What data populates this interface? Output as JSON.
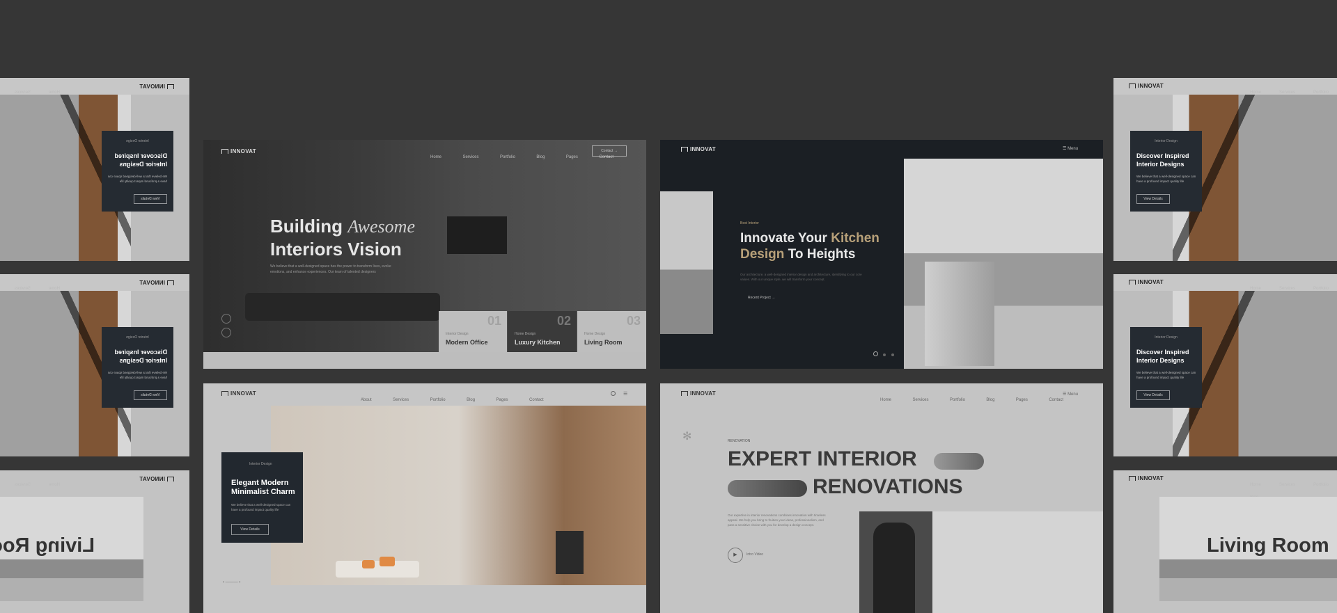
{
  "brand": "INNOVAT",
  "side_cards": {
    "menu": [
      "Home",
      "Services",
      "Portfolio",
      "Blog"
    ],
    "eyebrow": "Interior Design",
    "title": "Discover Inspired Interior Designs",
    "text": "We believe that a well-designed space can have a profound impact quality life",
    "button": "View Details",
    "living_room_title": "Living Room"
  },
  "card1": {
    "nav": [
      "Home",
      "Services",
      "Portfolio",
      "Blog",
      "Pages",
      "Contact"
    ],
    "contact_button": "Contact →",
    "headline_1": "Building",
    "headline_1_italic": "Awesome",
    "headline_2": "Interiors Vision",
    "desc": "We believe that a well-designed space has the power to transform lives, evoke emotions, and enhance experiences. Our team of talented designers",
    "tabs": [
      {
        "num": "01",
        "eyebrow": "Interior Design",
        "label": "Modern Office"
      },
      {
        "num": "02",
        "eyebrow": "Home Design",
        "label": "Luxury Kitchen"
      },
      {
        "num": "03",
        "eyebrow": "Home Design",
        "label": "Living Room"
      }
    ]
  },
  "card2": {
    "menu": "Menu",
    "eyebrow": "Best Interior",
    "headline_1": "Innovate Your",
    "headline_accent_1": "Kitchen",
    "headline_accent_2": "Design",
    "headline_2": "To Heights",
    "desc": "Our architecture, a well-designed interior design and architecture, identifying to our core values. With our unique style, we will transform your concept.",
    "cta": "Recent Project →"
  },
  "card3": {
    "nav": [
      "About",
      "Services",
      "Portfolio",
      "Blog",
      "Pages",
      "Contact"
    ],
    "eyebrow": "Interior Design",
    "title": "Elegant Modern Minimalist Charm",
    "text": "We believe that a well-designed space can have a profound impact quality life",
    "button": "View Details"
  },
  "card4": {
    "nav": [
      "Home",
      "Services",
      "Portfolio",
      "Blog",
      "Pages",
      "Contact"
    ],
    "menu": "Menu",
    "eyebrow": "RENOVATION",
    "headline_1": "EXPERT INTERIOR",
    "headline_2": "RENOVATIONS",
    "desc": "Our expertise in interior renovations combines innovation with timeless appeal. We help you bring to fruition your ideas, professionalism, and pass a sensitive choice with you for develop a design concept.",
    "play_label": "Intro Video"
  },
  "colors": {
    "background": "#363636",
    "accent_gold": "#b7a079",
    "dark_panel": "#1b1f24"
  }
}
